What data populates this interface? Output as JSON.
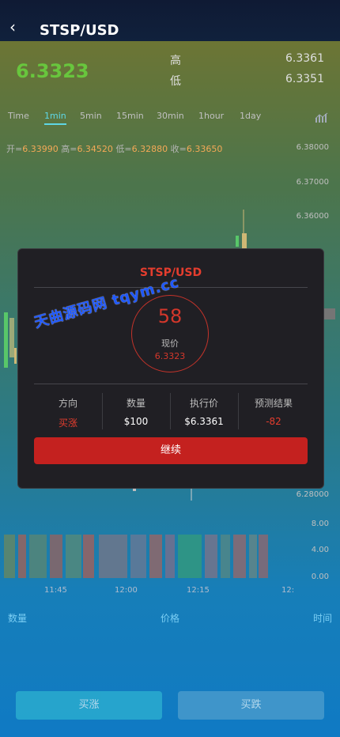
{
  "header": {
    "title": "STSP/USD",
    "back_icon": "chevron-left-icon"
  },
  "ticker": {
    "price": "6.3323",
    "high_label": "高",
    "high_value": "6.3361",
    "low_label": "低",
    "low_value": "6.3351"
  },
  "tabs": [
    "Time",
    "1min",
    "5min",
    "15min",
    "30min",
    "1hour",
    "1day"
  ],
  "active_tab": "1min",
  "ohlc": {
    "open_label": "开=",
    "open": "6.33990",
    "high_label": "高=",
    "high": "6.34520",
    "low_label": "低=",
    "low": "6.32880",
    "close_label": "收=",
    "close": "6.33650"
  },
  "axis_prices": [
    "6.38000",
    "6.37000",
    "6.36000",
    "6.28000"
  ],
  "volume_axis": [
    "8.00",
    "4.00",
    "0.00"
  ],
  "time_labels": [
    "11:45",
    "12:00",
    "12:15",
    "12:"
  ],
  "bottom_headers": {
    "qty": "数量",
    "price": "价格",
    "time": "时间"
  },
  "buttons": {
    "buy_rise": "买涨",
    "buy_fall": "买跌"
  },
  "modal": {
    "title": "STSP/USD",
    "countdown": "58",
    "current_label": "现价",
    "current_price": "6.3323",
    "columns": [
      {
        "label": "方向",
        "value": "买涨"
      },
      {
        "label": "数量",
        "value": "$100"
      },
      {
        "label": "执行价",
        "value": "$6.3361"
      },
      {
        "label": "预测结果",
        "value": "-82"
      }
    ],
    "continue_label": "继续"
  },
  "watermark": "天曲源码网 tqym.cc",
  "colors": {
    "price_up": "#6ccf3f",
    "accent_red": "#c4211f",
    "tab_active": "#61e0ef"
  }
}
